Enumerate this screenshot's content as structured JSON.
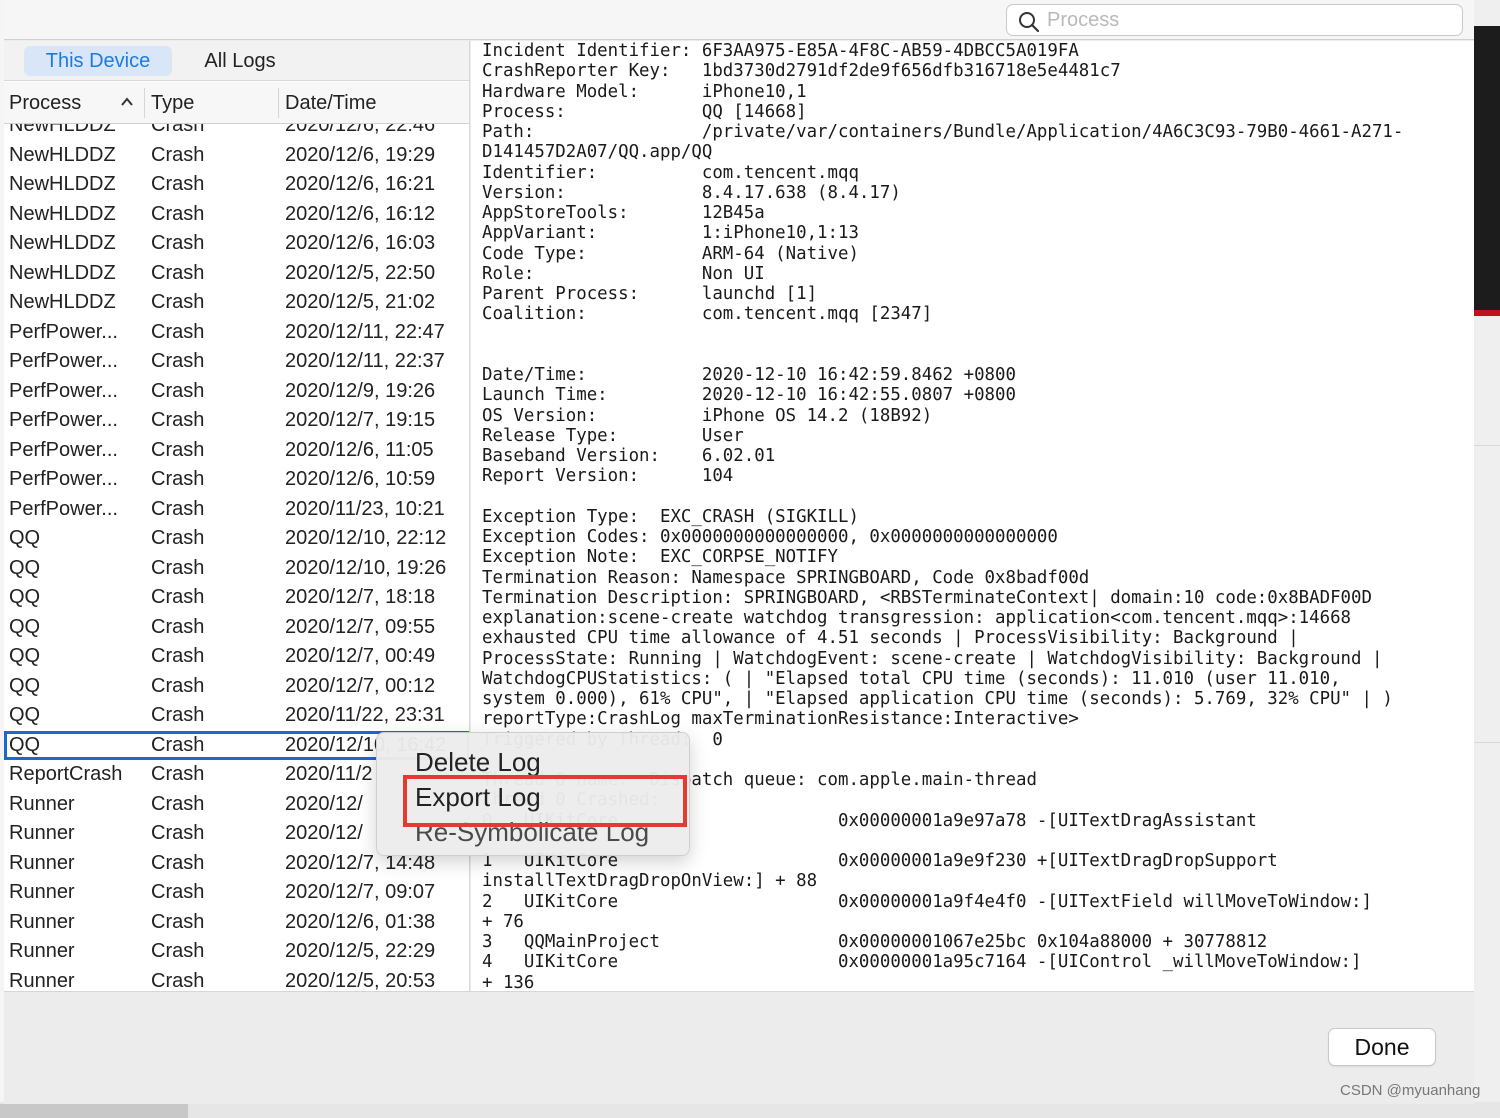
{
  "search": {
    "placeholder": "Process"
  },
  "tabs": {
    "active": "This Device",
    "other": "All Logs"
  },
  "columns": {
    "process": "Process",
    "type": "Type",
    "datetime": "Date/Time"
  },
  "sort_indicator": "^",
  "rows": [
    {
      "process": "NewHLDDZ",
      "type": "Crash",
      "date": "2020/12/6, 22:46"
    },
    {
      "process": "NewHLDDZ",
      "type": "Crash",
      "date": "2020/12/6, 19:29"
    },
    {
      "process": "NewHLDDZ",
      "type": "Crash",
      "date": "2020/12/6, 16:21"
    },
    {
      "process": "NewHLDDZ",
      "type": "Crash",
      "date": "2020/12/6, 16:12"
    },
    {
      "process": "NewHLDDZ",
      "type": "Crash",
      "date": "2020/12/6, 16:03"
    },
    {
      "process": "NewHLDDZ",
      "type": "Crash",
      "date": "2020/12/5, 22:50"
    },
    {
      "process": "NewHLDDZ",
      "type": "Crash",
      "date": "2020/12/5, 21:02"
    },
    {
      "process": "PerfPower...",
      "type": "Crash",
      "date": "2020/12/11, 22:47"
    },
    {
      "process": "PerfPower...",
      "type": "Crash",
      "date": "2020/12/11, 22:37"
    },
    {
      "process": "PerfPower...",
      "type": "Crash",
      "date": "2020/12/9, 19:26"
    },
    {
      "process": "PerfPower...",
      "type": "Crash",
      "date": "2020/12/7, 19:15"
    },
    {
      "process": "PerfPower...",
      "type": "Crash",
      "date": "2020/12/6, 11:05"
    },
    {
      "process": "PerfPower...",
      "type": "Crash",
      "date": "2020/12/6, 10:59"
    },
    {
      "process": "PerfPower...",
      "type": "Crash",
      "date": "2020/11/23, 10:21"
    },
    {
      "process": "QQ",
      "type": "Crash",
      "date": "2020/12/10, 22:12"
    },
    {
      "process": "QQ",
      "type": "Crash",
      "date": "2020/12/10, 19:26"
    },
    {
      "process": "QQ",
      "type": "Crash",
      "date": "2020/12/7, 18:18"
    },
    {
      "process": "QQ",
      "type": "Crash",
      "date": "2020/12/7, 09:55"
    },
    {
      "process": "QQ",
      "type": "Crash",
      "date": "2020/12/7, 00:49"
    },
    {
      "process": "QQ",
      "type": "Crash",
      "date": "2020/12/7, 00:12"
    },
    {
      "process": "QQ",
      "type": "Crash",
      "date": "2020/11/22, 23:31"
    },
    {
      "process": "QQ",
      "type": "Crash",
      "date": "2020/12/10, 16:42"
    },
    {
      "process": "ReportCrash",
      "type": "Crash",
      "date": "2020/11/2"
    },
    {
      "process": "Runner",
      "type": "Crash",
      "date": "2020/12/"
    },
    {
      "process": "Runner",
      "type": "Crash",
      "date": "2020/12/"
    },
    {
      "process": "Runner",
      "type": "Crash",
      "date": "2020/12/7, 14:48"
    },
    {
      "process": "Runner",
      "type": "Crash",
      "date": "2020/12/7, 09:07"
    },
    {
      "process": "Runner",
      "type": "Crash",
      "date": "2020/12/6, 01:38"
    },
    {
      "process": "Runner",
      "type": "Crash",
      "date": "2020/12/5, 22:29"
    },
    {
      "process": "Runner",
      "type": "Crash",
      "date": "2020/12/5, 20:53"
    }
  ],
  "selected_row_index": 21,
  "log_text": "Incident Identifier: 6F3AA975-E85A-4F8C-AB59-4DBCC5A019FA\nCrashReporter Key:   1bd3730d2791df2de9f656dfb316718e5e4481c7\nHardware Model:      iPhone10,1\nProcess:             QQ [14668]\nPath:                /private/var/containers/Bundle/Application/4A6C3C93-79B0-4661-A271-\nD141457D2A07/QQ.app/QQ\nIdentifier:          com.tencent.mqq\nVersion:             8.4.17.638 (8.4.17)\nAppStoreTools:       12B45a\nAppVariant:          1:iPhone10,1:13\nCode Type:           ARM-64 (Native)\nRole:                Non UI\nParent Process:      launchd [1]\nCoalition:           com.tencent.mqq [2347]\n\n\nDate/Time:           2020-12-10 16:42:59.8462 +0800\nLaunch Time:         2020-12-10 16:42:55.0807 +0800\nOS Version:          iPhone OS 14.2 (18B92)\nRelease Type:        User\nBaseband Version:    6.02.01\nReport Version:      104\n\nException Type:  EXC_CRASH (SIGKILL)\nException Codes: 0x0000000000000000, 0x0000000000000000\nException Note:  EXC_CORPSE_NOTIFY\nTermination Reason: Namespace SPRINGBOARD, Code 0x8badf00d\nTermination Description: SPRINGBOARD, <RBSTerminateContext| domain:10 code:0x8BADF00D\nexplanation:scene-create watchdog transgression: application<com.tencent.mqq>:14668\nexhausted CPU time allowance of 4.51 seconds | ProcessVisibility: Background |\nProcessState: Running | WatchdogEvent: scene-create | WatchdogVisibility: Background |\nWatchdogCPUStatistics: ( | \"Elapsed total CPU time (seconds): 11.010 (user 11.010,\nsystem 0.000), 61% CPU\", | \"Elapsed application CPU time (seconds): 5.769, 32% CPU\" | )\nreportType:CrashLog maxTerminationResistance:Interactive>\nTriggered by Thread:  0\n\nThread 0 name:  Dispatch queue: com.apple.main-thread\nThread 0 Crashed:\n0   UIKitCore                     0x00000001a9e97a78 -[UITextDragAssistant\n\n1   UIKitCore                     0x00000001a9e9f230 +[UITextDragDropSupport\ninstallTextDragDropOnView:] + 88\n2   UIKitCore                     0x00000001a9f4e4f0 -[UITextField willMoveToWindow:]\n+ 76\n3   QQMainProject                 0x00000001067e25bc 0x104a88000 + 30778812\n4   UIKitCore                     0x00000001a95c7164 -[UIControl _willMoveToWindow:]\n+ 136",
  "context_menu": {
    "items": [
      "Delete Log",
      "Export Log",
      "Re-Symbolicate Log"
    ],
    "highlighted": "Export Log"
  },
  "done_button": "Done",
  "watermark": "CSDN @myuanhang"
}
